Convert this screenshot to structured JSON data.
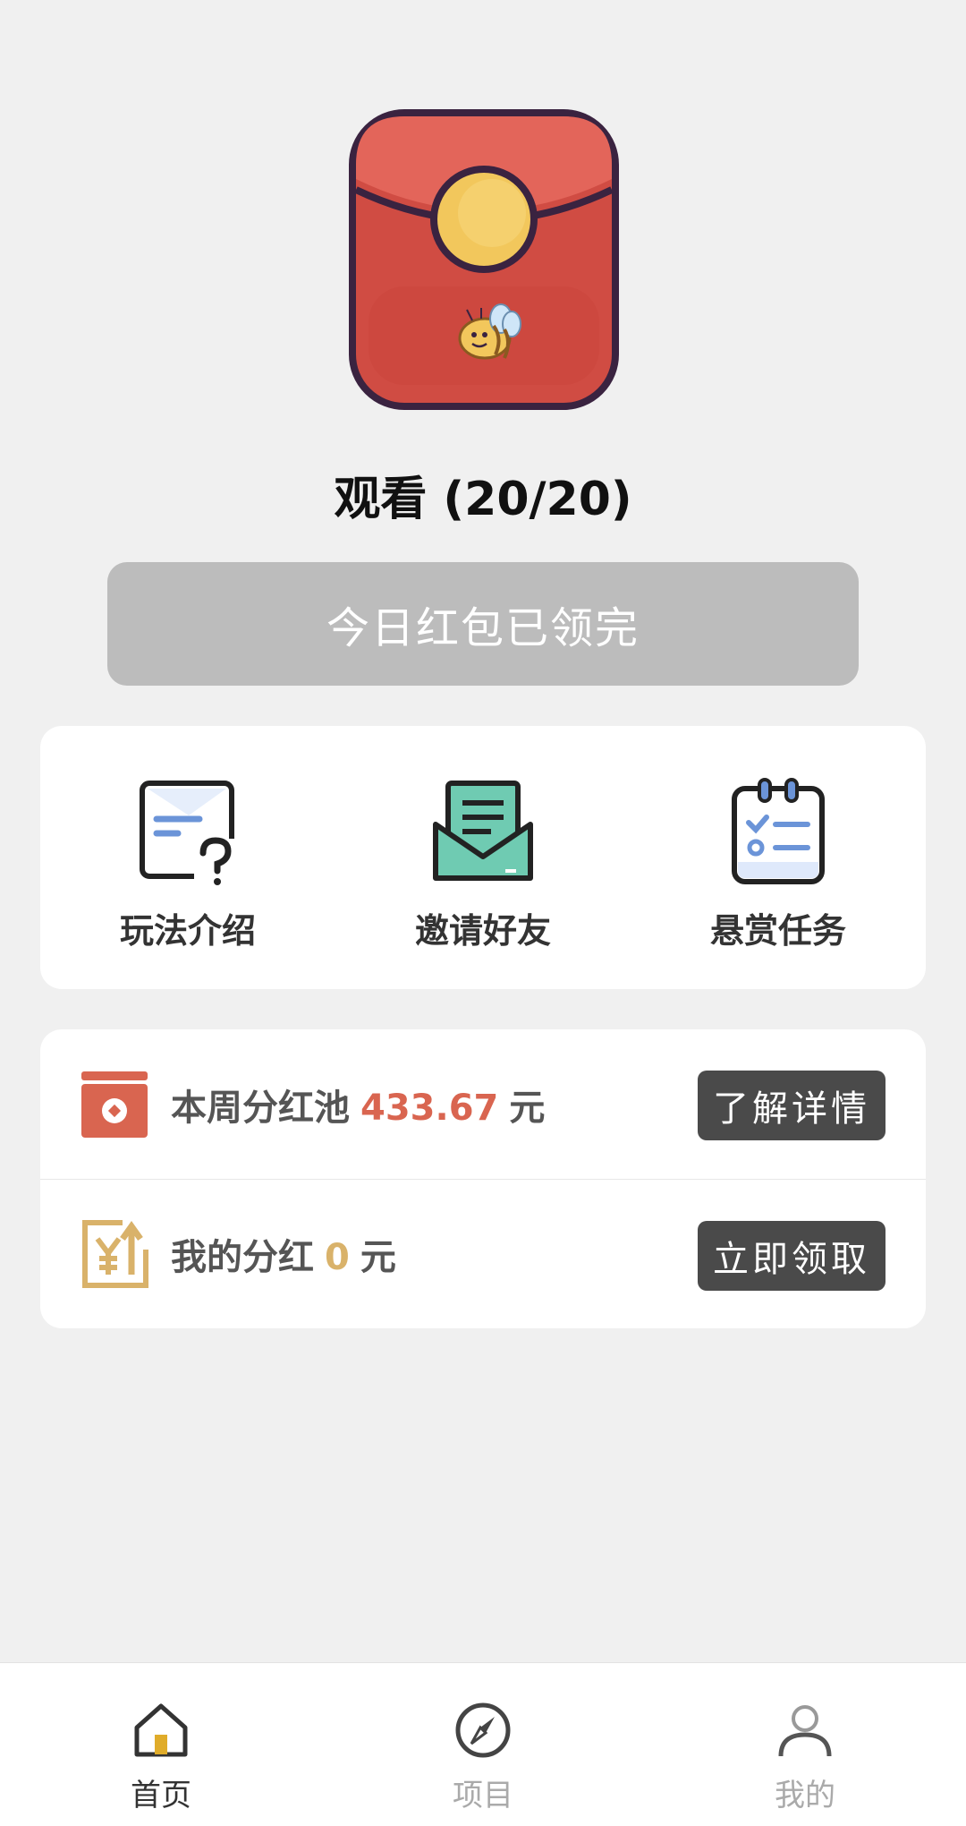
{
  "hero": {
    "icon": "red-envelope-bee-icon",
    "watch_title": "观看 (20/20)",
    "claim_button": "今日红包已领完"
  },
  "menu": [
    {
      "label": "玩法介绍",
      "icon": "help-doc-icon"
    },
    {
      "label": "邀请好友",
      "icon": "envelope-invite-icon"
    },
    {
      "label": "悬赏任务",
      "icon": "task-list-icon"
    }
  ],
  "bonus": {
    "pool": {
      "prefix": "本周分红池",
      "amount": "433.67",
      "unit": "元",
      "button": "了解详情",
      "icon": "red-box-icon"
    },
    "mine": {
      "prefix": "我的分红",
      "amount": "0",
      "unit": "元",
      "button": "立即领取",
      "icon": "yuan-up-icon"
    }
  },
  "tabbar": {
    "active": "home",
    "tabs": [
      {
        "label": "首页",
        "icon": "home-icon"
      },
      {
        "label": "项目",
        "icon": "compass-icon"
      },
      {
        "label": "我的",
        "icon": "user-icon"
      }
    ]
  },
  "colors": {
    "envelope_red": "#df5b4f",
    "coin_yellow": "#f2c75c",
    "amount_red": "#d96550",
    "amount_gold": "#d9b26a",
    "button_dark": "#4a4a4a",
    "disabled_gray": "#bcbcbc"
  }
}
